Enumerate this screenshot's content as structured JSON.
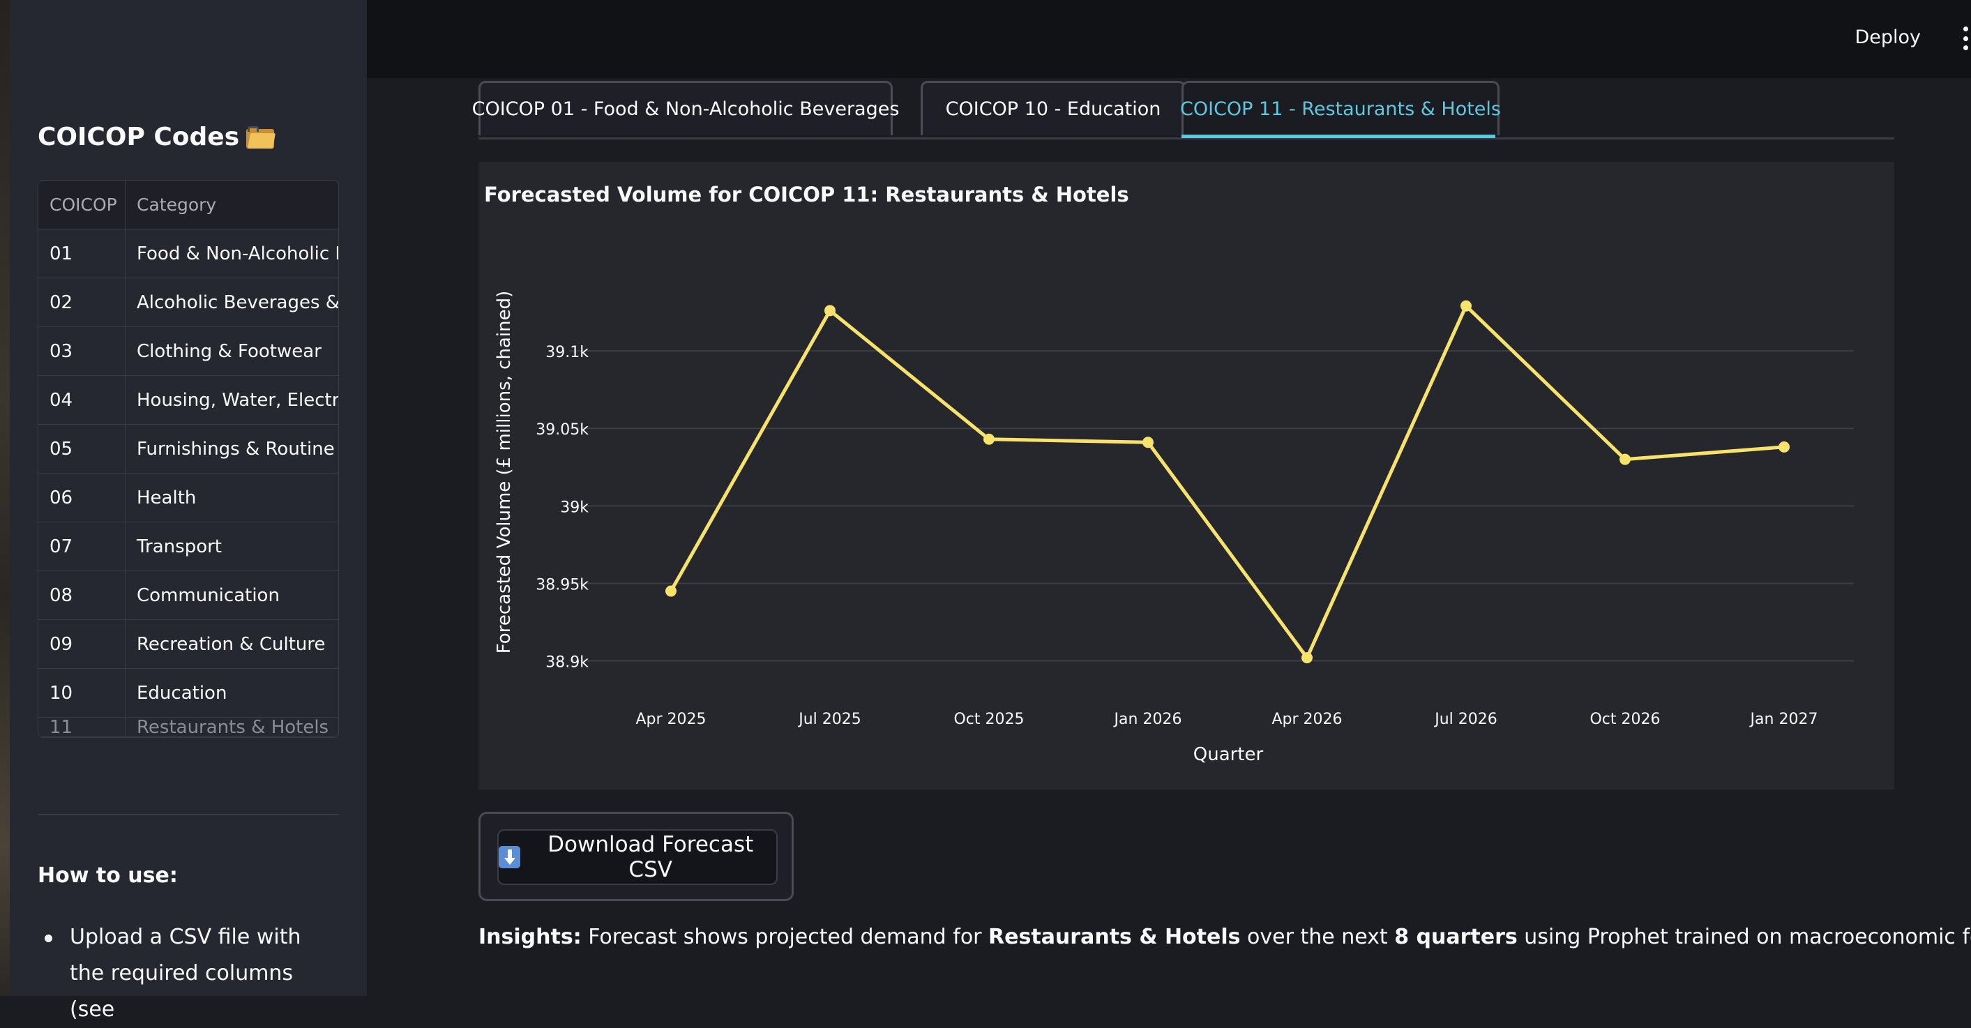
{
  "header": {
    "deploy_label": "Deploy",
    "menu_icon": "kebab-menu-icon"
  },
  "sidebar": {
    "title": "COICOP Codes",
    "title_icon": "folder-icon",
    "table": {
      "columns": [
        "COICOP",
        "Category"
      ],
      "rows": [
        {
          "code": "01",
          "category": "Food & Non-Alcoholic Beverages"
        },
        {
          "code": "02",
          "category": "Alcoholic Beverages & Tobacco"
        },
        {
          "code": "03",
          "category": "Clothing & Footwear"
        },
        {
          "code": "04",
          "category": "Housing, Water, Electricity"
        },
        {
          "code": "05",
          "category": "Furnishings & Routine Household"
        },
        {
          "code": "06",
          "category": "Health"
        },
        {
          "code": "07",
          "category": "Transport"
        },
        {
          "code": "08",
          "category": "Communication"
        },
        {
          "code": "09",
          "category": "Recreation & Culture"
        },
        {
          "code": "10",
          "category": "Education"
        },
        {
          "code": "11",
          "category": "Restaurants & Hotels"
        }
      ]
    },
    "howto_title": "How to use:",
    "howto_items": [
      "Upload a CSV file with the required columns (see"
    ]
  },
  "tabs": [
    {
      "label": "COICOP 01 - Food & Non-Alcoholic Beverages",
      "active": false
    },
    {
      "label": "COICOP 10 - Education",
      "active": false
    },
    {
      "label": "COICOP 11 - Restaurants & Hotels",
      "active": true
    }
  ],
  "chart_data": {
    "type": "line",
    "title": "Forecasted Volume for COICOP 11: Restaurants & Hotels",
    "xlabel": "Quarter",
    "ylabel": "Forecasted Volume (£ millions, chained)",
    "categories": [
      "Apr 2025",
      "Jul 2025",
      "Oct 2025",
      "Jan 2026",
      "Apr 2026",
      "Jul 2026",
      "Oct 2026",
      "Jan 2027"
    ],
    "series": [
      {
        "values": [
          38945,
          39126,
          39043,
          39041,
          38902,
          39129,
          39030,
          39038
        ]
      }
    ],
    "ylim": [
      38880,
      39150
    ],
    "yticks": [
      38900,
      38950,
      39000,
      39050,
      39100
    ],
    "ytick_labels": [
      "38.9k",
      "38.95k",
      "39k",
      "39.05k",
      "39.1k"
    ],
    "grid": true,
    "line_color": "#f7e26b"
  },
  "download": {
    "label": "Download Forecast CSV",
    "icon": "download-arrow-icon"
  },
  "insights": {
    "prefix": "Insights:",
    "text1": " Forecast shows projected demand for ",
    "category": "Restaurants & Hotels",
    "text2": " over the next ",
    "horizon": "8 quarters",
    "text3": " using Prophet trained on macroeconomic features."
  }
}
